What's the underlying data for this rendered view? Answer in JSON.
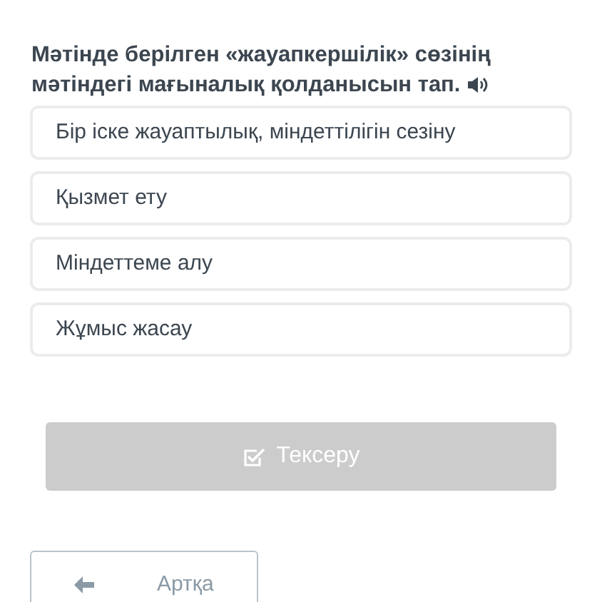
{
  "question": {
    "text": "Мәтінде берілген «жауапкершілік» сөзінің мәтіндегі мағыналық қолданысын тап."
  },
  "options": [
    {
      "label": "Бір іске жауаптылық, міндеттілігін сезіну",
      "selected": false
    },
    {
      "label": "Қызмет ету",
      "selected": false
    },
    {
      "label": "Міндеттеме алу",
      "selected": false
    },
    {
      "label": "Жұмыс жасау",
      "selected": false
    }
  ],
  "check_button": {
    "label": "Тексеру",
    "disabled": true
  },
  "back_button": {
    "label": "Артқа"
  }
}
